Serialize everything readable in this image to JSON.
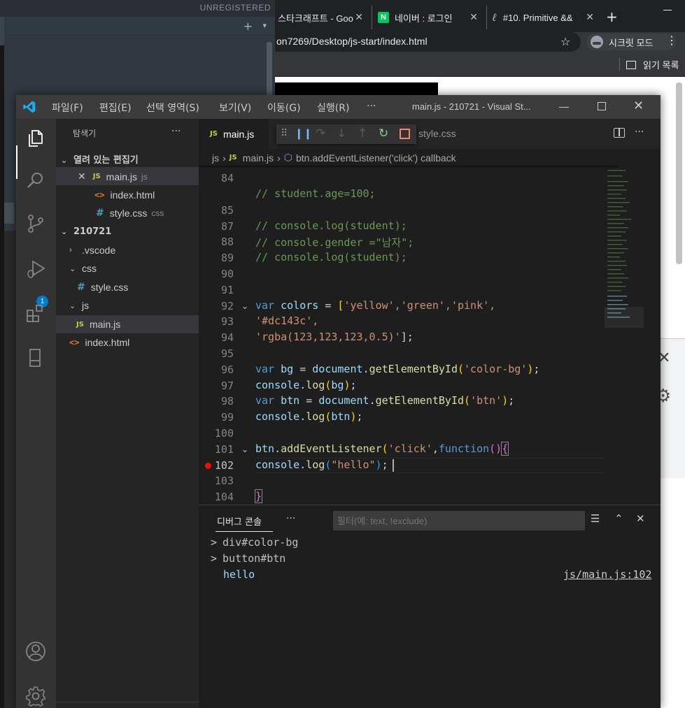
{
  "background": {
    "sublime": {
      "unregistered": "UNREGISTERED",
      "plus": "+",
      "down": "▾"
    },
    "chrome": {
      "tabs": [
        {
          "title": "스타크래프트 - Goo"
        },
        {
          "title": "네이버 : 로그인",
          "favicon": "N"
        },
        {
          "title": "#10. Primitive &&"
        }
      ],
      "new_tab": "+",
      "url": "on7269/Desktop/js-start/index.html",
      "incognito_label": "시크릿 모드",
      "reading_list_label": "읽기 목록"
    }
  },
  "vscode": {
    "menu": [
      "파일(F)",
      "편집(E)",
      "선택 영역(S)",
      "보기(V)",
      "이동(G)",
      "실행(R)",
      "···"
    ],
    "window_title": "main.js - 210721 - Visual St...",
    "debug_badge": "1",
    "explorer": {
      "title": "탐색기",
      "more": "···",
      "open_editors_label": "열려 있는 편집기",
      "open_editors": [
        {
          "name": "main.js",
          "desc": "js",
          "type": "js"
        },
        {
          "name": "index.html",
          "desc": "",
          "type": "html"
        },
        {
          "name": "style.css",
          "desc": "css",
          "type": "css"
        }
      ],
      "workspace_label": "210721",
      "tree": [
        {
          "name": ".vscode",
          "kind": "folder"
        },
        {
          "name": "css",
          "kind": "folder"
        },
        {
          "name": "style.css",
          "kind": "css"
        },
        {
          "name": "js",
          "kind": "folder"
        },
        {
          "name": "main.js",
          "kind": "js"
        },
        {
          "name": "index.html",
          "kind": "html"
        }
      ]
    },
    "tabs": {
      "active": "main.js",
      "other": "style.css"
    },
    "breadcrumb": [
      "js",
      "main.js",
      "btn.addEventListener('click') callback"
    ],
    "line_numbers": [
      "84",
      "85",
      "87",
      "88",
      "89",
      "90",
      "91",
      "92",
      "93",
      "94",
      "95",
      "96",
      "97",
      "98",
      "99",
      "100",
      "101",
      "102",
      "103",
      "104"
    ],
    "code": {
      "l84": "// student.age=100;",
      "l87": "// console.log(student);",
      "l88": "// console.gender =\"남자\";",
      "l89": "// console.log(student);",
      "l92_kw": "var",
      "l92_name": " colors",
      "l92_eq": " = ",
      "l92_items": "'yellow','green','pink',",
      "l93": "'#dc143c',",
      "l94_str": "'rgba(123,123,123,0.5)'",
      "l94_end": "];",
      "l96_kw": "var",
      "l96_name": " bg",
      "l96_eq": " = ",
      "l96_obj": "document",
      "l96_fn": "getElementById",
      "l96_str": "'color-bg'",
      "l97_obj": "console",
      "l97_fn": "log",
      "l97_arg": "bg",
      "l98_kw": "var",
      "l98_name": " btn",
      "l98_eq": " = ",
      "l98_obj": "document",
      "l98_fn": "getElementById",
      "l98_str": "'btn'",
      "l99_obj": "console",
      "l99_fn": "log",
      "l99_arg": "btn",
      "l101_obj": "btn",
      "l101_fn": "addEventListener",
      "l101_str": "'click'",
      "l101_kw": "function",
      "l102_obj": "console",
      "l102_fn": "log",
      "l102_str": "\"hello\"",
      "l104": "}"
    },
    "panel": {
      "tab": "디버그 콘솔",
      "more": "···",
      "filter_placeholder": "필터(예: text, !exclude)",
      "output": [
        {
          "text": "div#color-bg"
        },
        {
          "text": "button#btn"
        }
      ],
      "hello": "hello",
      "source": "js/main.js:102"
    }
  }
}
